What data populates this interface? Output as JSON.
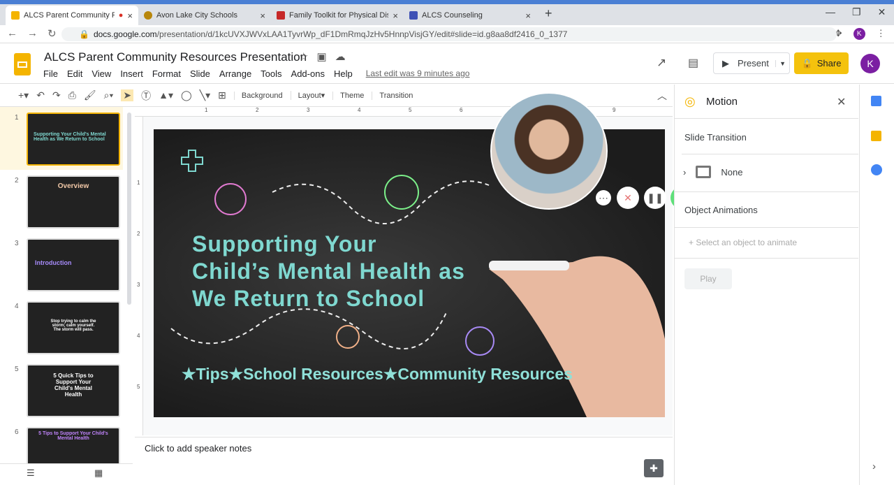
{
  "browser": {
    "tabs": [
      {
        "title": "ALCS Parent Community Resources Presentation",
        "active": true
      },
      {
        "title": "Avon Lake City Schools"
      },
      {
        "title": "Family Toolkit for Physical Distancing"
      },
      {
        "title": "ALCS Counseling"
      }
    ],
    "url_host": "docs.google.com",
    "url_path": "/presentation/d/1kcUVXJWVxLAA1TyvrWp_dF1DmRmqJzHv5HnnpVisjGY/edit#slide=id.g8aa8df2416_0_1377",
    "profile_initial": "K"
  },
  "doc": {
    "title": "ALCS Parent Community Resources Presentation",
    "menu": [
      "File",
      "Edit",
      "View",
      "Insert",
      "Format",
      "Slide",
      "Arrange",
      "Tools",
      "Add-ons",
      "Help"
    ],
    "last_edit": "Last edit was 9 minutes ago",
    "present": "Present",
    "share": "Share",
    "avatar": "K"
  },
  "toolbar": {
    "background": "Background",
    "layout": "Layout",
    "theme": "Theme",
    "transition": "Transition"
  },
  "slides": [
    {
      "num": "1",
      "title": "Supporting Your Child's Mental Health as We Return to School"
    },
    {
      "num": "2",
      "title": "Overview"
    },
    {
      "num": "3",
      "title": "Introduction"
    },
    {
      "num": "4",
      "title": "Stop trying to calm the storm; calm yourself. The storm will pass."
    },
    {
      "num": "5",
      "title": "5 Quick Tips to Support Your Child's Mental Health"
    },
    {
      "num": "6",
      "title": "5 Tips to Support Your Child's Mental Health"
    }
  ],
  "current_slide": {
    "line1": "Supporting Your",
    "line2": "Child’s Mental Health as",
    "line3": "We Return to School",
    "subtitle": "★Tips★School Resources★Community Resources"
  },
  "ruler": [
    "1",
    "2",
    "3",
    "4",
    "5",
    "6",
    "7",
    "8",
    "9"
  ],
  "vruler": [
    "1",
    "2",
    "3",
    "4",
    "5"
  ],
  "notes": {
    "placeholder": "Click to add speaker notes"
  },
  "motion": {
    "title": "Motion",
    "slide_transition": "Slide Transition",
    "transition_value": "None",
    "object_animations": "Object Animations",
    "add_animation": "Select an object to animate",
    "play": "Play"
  },
  "colors": {
    "share": "#f4c20d",
    "avatar": "#7b1fa2",
    "accent": "#1a73e8"
  }
}
